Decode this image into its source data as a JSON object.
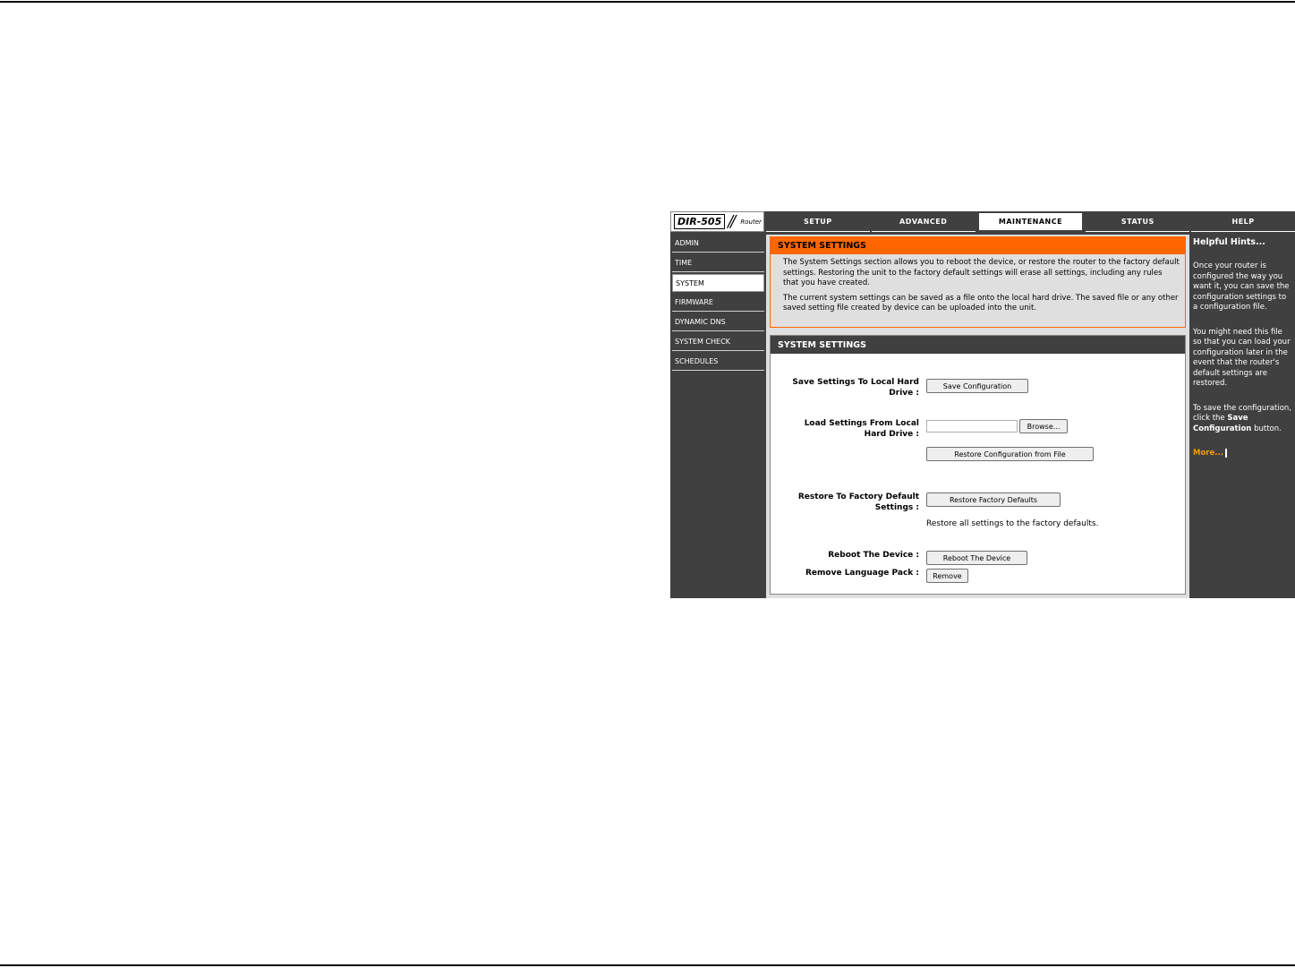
{
  "header": {
    "model": "DIR-505",
    "slash": "//",
    "device_type": "Router",
    "tabs": [
      {
        "label": "SETUP",
        "active": false
      },
      {
        "label": "ADVANCED",
        "active": false
      },
      {
        "label": "MAINTENANCE",
        "active": true
      },
      {
        "label": "STATUS",
        "active": false
      },
      {
        "label": "HELP",
        "active": false
      }
    ]
  },
  "sidebar": {
    "items": [
      {
        "label": "ADMIN",
        "active": false
      },
      {
        "label": "TIME",
        "active": false
      },
      {
        "label": "SYSTEM",
        "active": true
      },
      {
        "label": "FIRMWARE",
        "active": false
      },
      {
        "label": "DYNAMIC DNS",
        "active": false
      },
      {
        "label": "SYSTEM CHECK",
        "active": false
      },
      {
        "label": "SCHEDULES",
        "active": false
      }
    ]
  },
  "intro": {
    "title": "SYSTEM SETTINGS",
    "paragraph1": "The System Settings section allows you to reboot the device, or restore the router to the factory default settings. Restoring the unit to the factory default settings will erase all settings, including any rules that you have created.",
    "paragraph2": "The current system settings can be saved as a file onto the local hard drive. The saved file or any other saved setting file created by device can be uploaded into the unit."
  },
  "settings": {
    "title": "SYSTEM SETTINGS",
    "save_label_line1": "Save Settings To Local Hard",
    "save_label_line2": "Drive :",
    "save_button": "Save Configuration",
    "load_label_line1": "Load Settings From Local",
    "load_label_line2": "Hard Drive :",
    "file_input_value": "",
    "browse_button": "Browse...",
    "restore_file_button": "Restore Configuration from File",
    "factory_label_line1": "Restore To Factory Default",
    "factory_label_line2": "Settings :",
    "factory_button": "Restore Factory Defaults",
    "factory_note": "Restore all settings to the factory defaults.",
    "reboot_label": "Reboot The Device :",
    "reboot_button": "Reboot The Device",
    "remove_label": "Remove Language Pack :",
    "remove_button": "Remove"
  },
  "help": {
    "title": "Helpful Hints...",
    "para1": "Once your router is configured the way you want it, you can save the configuration settings to a configuration file.",
    "para2": "You might need this file so that you can load your configuration later in the event that the router's default settings are restored.",
    "para3_start": "To save the configuration, click the",
    "para3_bold": "Save Configuration",
    "para3_end": "button.",
    "more_link": "More..."
  },
  "colors": {
    "accent_orange": "#ff6600",
    "dark_gray": "#404040",
    "content_gray": "#dfdfdf",
    "link_orange": "#ff9900"
  }
}
